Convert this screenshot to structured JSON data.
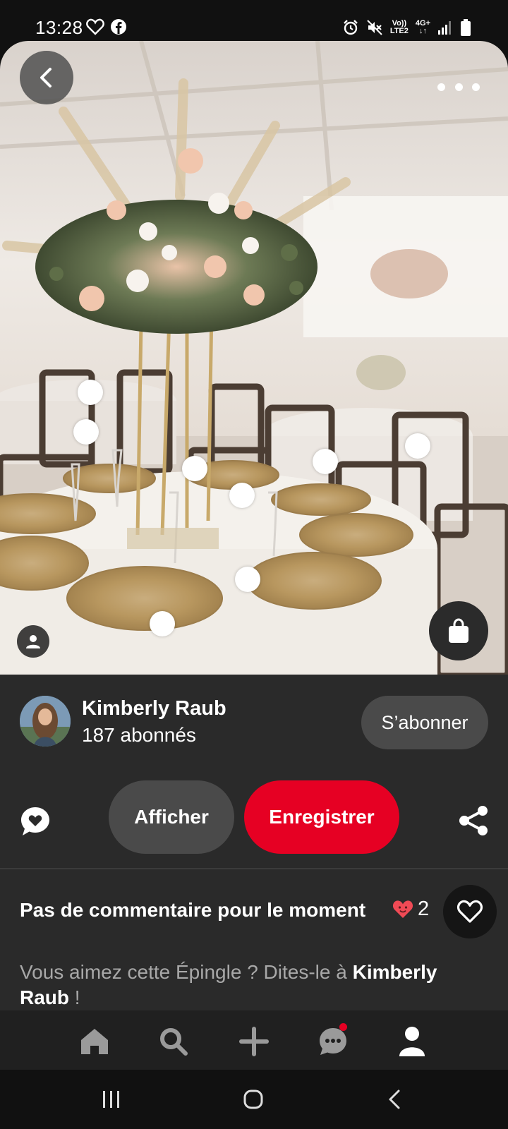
{
  "status_bar": {
    "time": "13:28",
    "left_icons": [
      "heart-outline-icon",
      "facebook-icon"
    ],
    "right_icons": [
      "alarm-icon",
      "mute-icon",
      "volte-icon",
      "4g-icon",
      "signal-icon",
      "battery-icon"
    ],
    "volte_line1": "Vo))",
    "volte_line2": "LTE2",
    "net_label": "4G+"
  },
  "pin": {
    "back_icon": "chevron-left-icon",
    "more_icon": "more-horizontal-icon",
    "hotspot_count": 10,
    "profile_icon": "person-icon",
    "shop_icon": "shopping-bag-icon"
  },
  "creator": {
    "name": "Kimberly Raub",
    "followers": "187 abonnés",
    "follow_label": "S’abonner"
  },
  "actions": {
    "comment_icon": "comment-heart-icon",
    "view_label": "Afficher",
    "save_label": "Enregistrer",
    "share_icon": "share-icon"
  },
  "comments": {
    "title": "Pas de commentaire pour le moment",
    "reaction_count": "2",
    "reaction_icon": "heart-face-icon",
    "like_icon": "heart-outline-icon"
  },
  "prompt": {
    "text_before": "Vous aimez cette Épingle ? Dites-le à ",
    "name": "Kimberly Raub",
    "text_after": " !"
  },
  "bottom_nav": {
    "items": [
      "home-icon",
      "search-icon",
      "plus-icon",
      "messages-icon",
      "profile-icon"
    ],
    "active": "profile-icon"
  },
  "system_nav": {
    "items": [
      "recents-icon",
      "home-circle-icon",
      "back-icon"
    ]
  },
  "colors": {
    "accent": "#e60023",
    "panel": "#2a2a2a",
    "button_grey": "#4a4a4a"
  }
}
